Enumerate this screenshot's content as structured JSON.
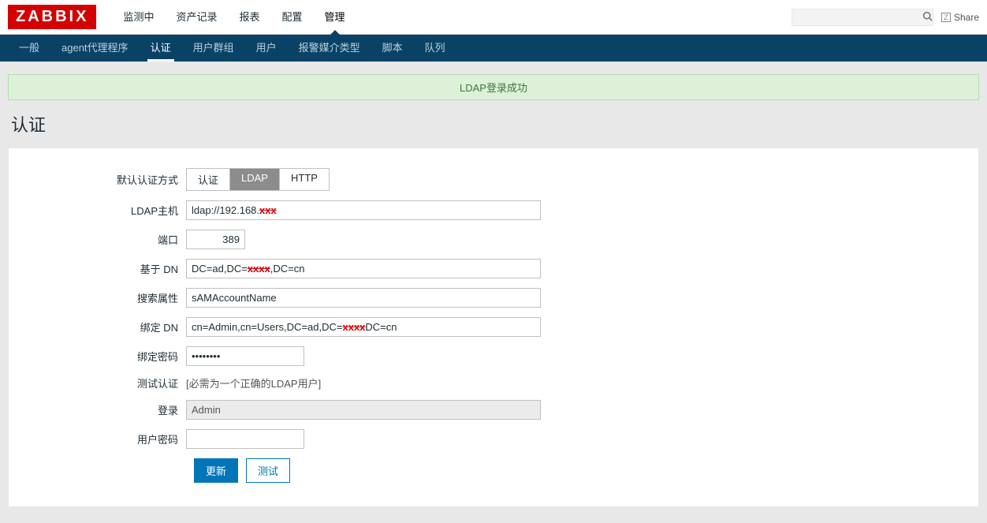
{
  "brand": "ZABBIX",
  "topnav": {
    "items": [
      {
        "label": "监测中"
      },
      {
        "label": "资产记录"
      },
      {
        "label": "报表"
      },
      {
        "label": "配置"
      },
      {
        "label": "管理"
      }
    ],
    "share": "Share",
    "search_placeholder": ""
  },
  "subnav": {
    "items": [
      {
        "label": "一般"
      },
      {
        "label": "agent代理程序"
      },
      {
        "label": "认证"
      },
      {
        "label": "用户群组"
      },
      {
        "label": "用户"
      },
      {
        "label": "报警媒介类型"
      },
      {
        "label": "脚本"
      },
      {
        "label": "队列"
      }
    ]
  },
  "message": "LDAP登录成功",
  "page_title": "认证",
  "form": {
    "auth_method_label": "默认认证方式",
    "auth_options": [
      "认证",
      "LDAP",
      "HTTP"
    ],
    "ldap_host_label": "LDAP主机",
    "ldap_host_value_prefix": "ldap://192.168.",
    "port_label": "端口",
    "port_value": "389",
    "base_dn_label": "基于 DN",
    "base_dn_prefix": "DC=ad,DC=",
    "base_dn_suffix": ",DC=cn",
    "search_attr_label": "搜索属性",
    "search_attr_value": "sAMAccountName",
    "bind_dn_label": "绑定 DN",
    "bind_dn_prefix": "cn=Admin,cn=Users,DC=ad,DC=",
    "bind_dn_suffix": "DC=cn",
    "bind_pwd_label": "绑定密码",
    "bind_pwd_value": "••••••••",
    "test_auth_label": "测试认证",
    "test_auth_hint": "[必需为一个正确的LDAP用户]",
    "login_label": "登录",
    "login_value": "Admin",
    "user_pwd_label": "用户密码",
    "user_pwd_value": "",
    "btn_update": "更新",
    "btn_test": "测试"
  }
}
